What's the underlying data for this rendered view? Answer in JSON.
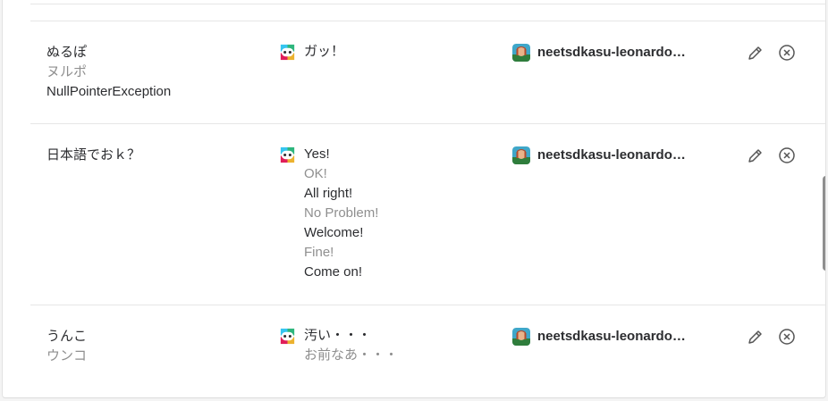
{
  "rows": [
    {
      "input": [
        "ぬるぽ",
        "ヌルポ",
        "NullPointerException"
      ],
      "responses": [
        "ガッ！"
      ],
      "user": "neetsdkasu-leonardo…"
    },
    {
      "input": [
        "日本語でおｋ？"
      ],
      "responses": [
        "Yes!",
        "OK!",
        "All right!",
        "No Problem!",
        "Welcome!",
        "Fine!",
        "Come on!"
      ],
      "user": "neetsdkasu-leonardo…"
    },
    {
      "input": [
        "うんこ",
        "ウンコ"
      ],
      "responses": [
        "汚い・・・",
        "お前なあ・・・"
      ],
      "user": "neetsdkasu-leonardo…"
    }
  ],
  "icons": {
    "bot": "slackbot-icon",
    "avatar": "user-avatar",
    "edit": "pencil-icon",
    "delete": "close-circle-icon"
  },
  "colors": {
    "primary_text": "#2c2d30",
    "secondary_text": "#8f8f8f",
    "divider": "#e6e6e6"
  }
}
